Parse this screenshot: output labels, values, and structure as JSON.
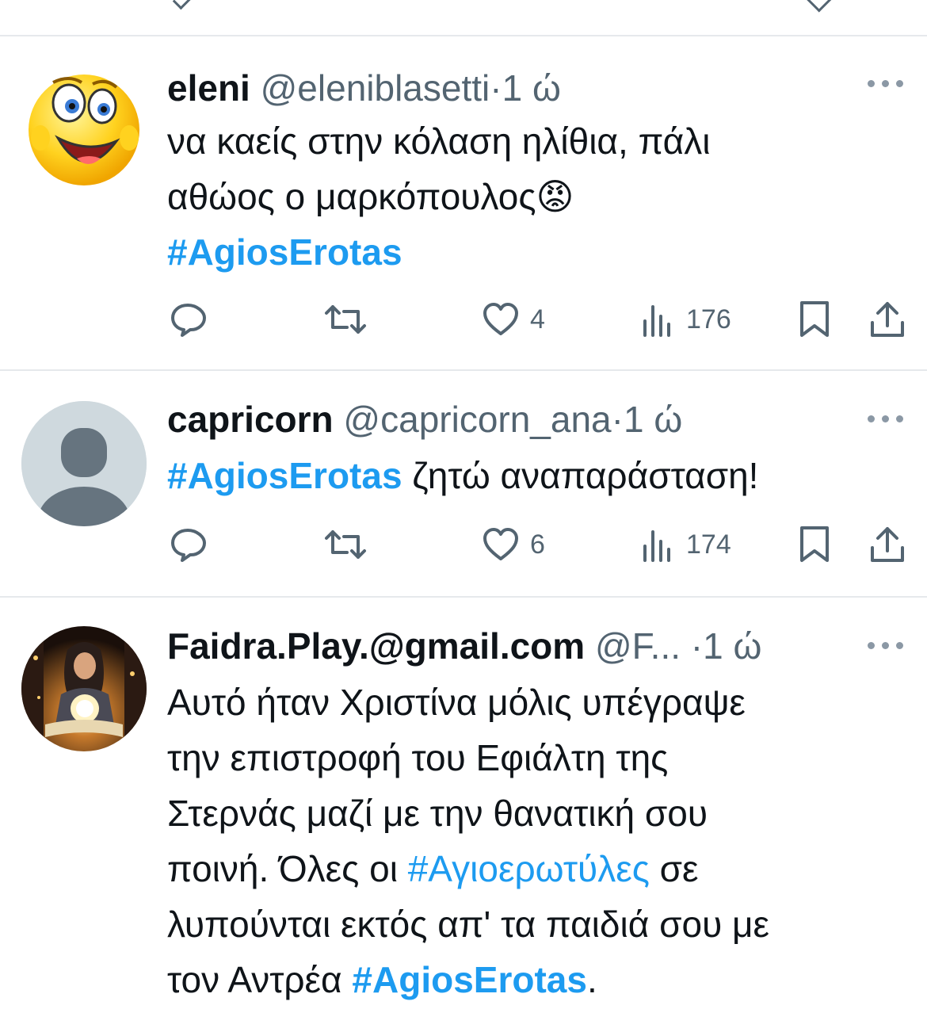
{
  "tweets": [
    {
      "display_name": "eleni",
      "handle": "@eleniblasetti",
      "separator": "·",
      "time": "1 ώ",
      "text_line1": "να καείς στην κόλαση ηλίθια, πάλι",
      "text_line2": "αθώος ο μαρκόπουλος",
      "emoji": "😡",
      "hashtag": "#AgiosErotas",
      "likes": "4",
      "views": "176",
      "avatar_icon": "smiley-emoji-avatar"
    },
    {
      "display_name": "capricorn",
      "handle": "@capricorn_ana",
      "separator": "·",
      "time": "1 ώ",
      "hashtag": "#AgiosErotas",
      "text_after_hashtag": " ζητώ αναπαράσταση!",
      "likes": "6",
      "views": "174",
      "avatar_icon": "default-profile-icon"
    },
    {
      "display_name": "Faidra.Play.@gmail.com",
      "handle": "@F...",
      "separator": "·",
      "time": "1 ώ",
      "line1": "Αυτό ήταν Χριστίνα μόλις υπέγραψε",
      "line2": "την επιστροφή του Εφιάλτη της",
      "line3": "Στερνάς μαζί με την θανατική σου",
      "line4_before": "ποινή. Όλες οι ",
      "line4_hashtag": "#Αγιοερωτύλες",
      "line4_after": " σε",
      "line5": "λυπούνται εκτός απ' τα παιδιά σου με",
      "line6_before": "τον Αντρέα ",
      "line6_hashtag": "#AgiosErotas",
      "line6_after": ".",
      "avatar_icon": "girl-reading-book-avatar"
    }
  ],
  "colors": {
    "text": "#0f1419",
    "secondary": "#536471",
    "link": "#1d9bf0",
    "divider": "#e6e9ec"
  }
}
